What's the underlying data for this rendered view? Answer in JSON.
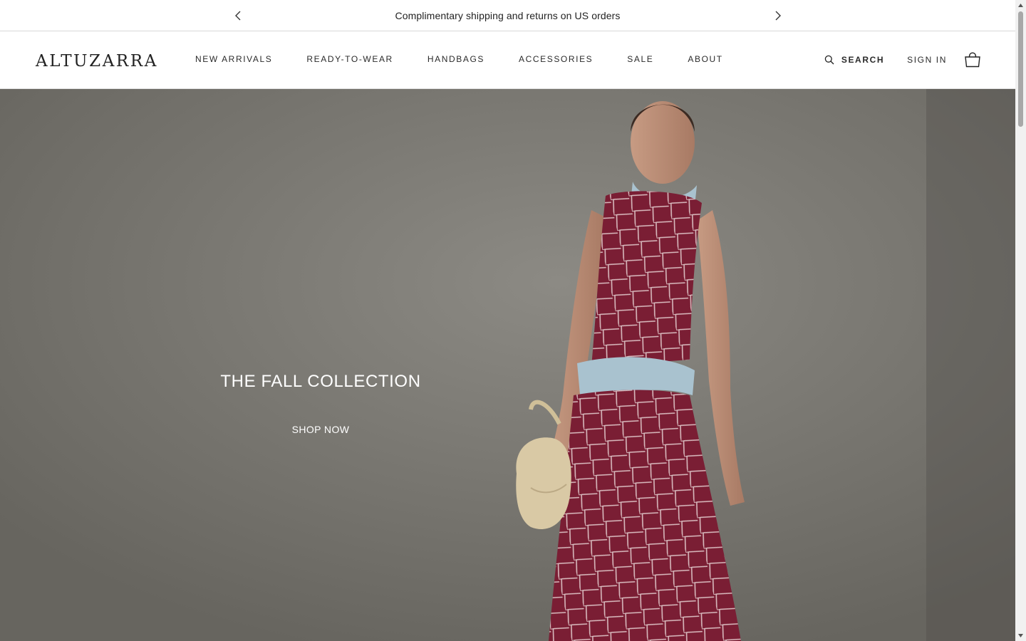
{
  "announcement": {
    "text": "Complimentary shipping and returns on US orders",
    "prev_icon": "chevron-left-icon",
    "next_icon": "chevron-right-icon"
  },
  "header": {
    "logo": "ALTUZARRA",
    "nav": [
      {
        "label": "NEW ARRIVALS"
      },
      {
        "label": "READY-TO-WEAR"
      },
      {
        "label": "HANDBAGS"
      },
      {
        "label": "ACCESSORIES"
      },
      {
        "label": "SALE"
      },
      {
        "label": "ABOUT"
      }
    ],
    "search_label": "SEARCH",
    "signin_label": "SIGN IN",
    "bag_icon": "shopping-bag-icon"
  },
  "hero": {
    "title": "THE FALL COLLECTION",
    "cta": "SHOP NOW",
    "colors": {
      "background": "#7b7974",
      "dress": "#7a1e34",
      "scarf": "#a9c2cf",
      "handbag": "#d9c9a5"
    }
  }
}
